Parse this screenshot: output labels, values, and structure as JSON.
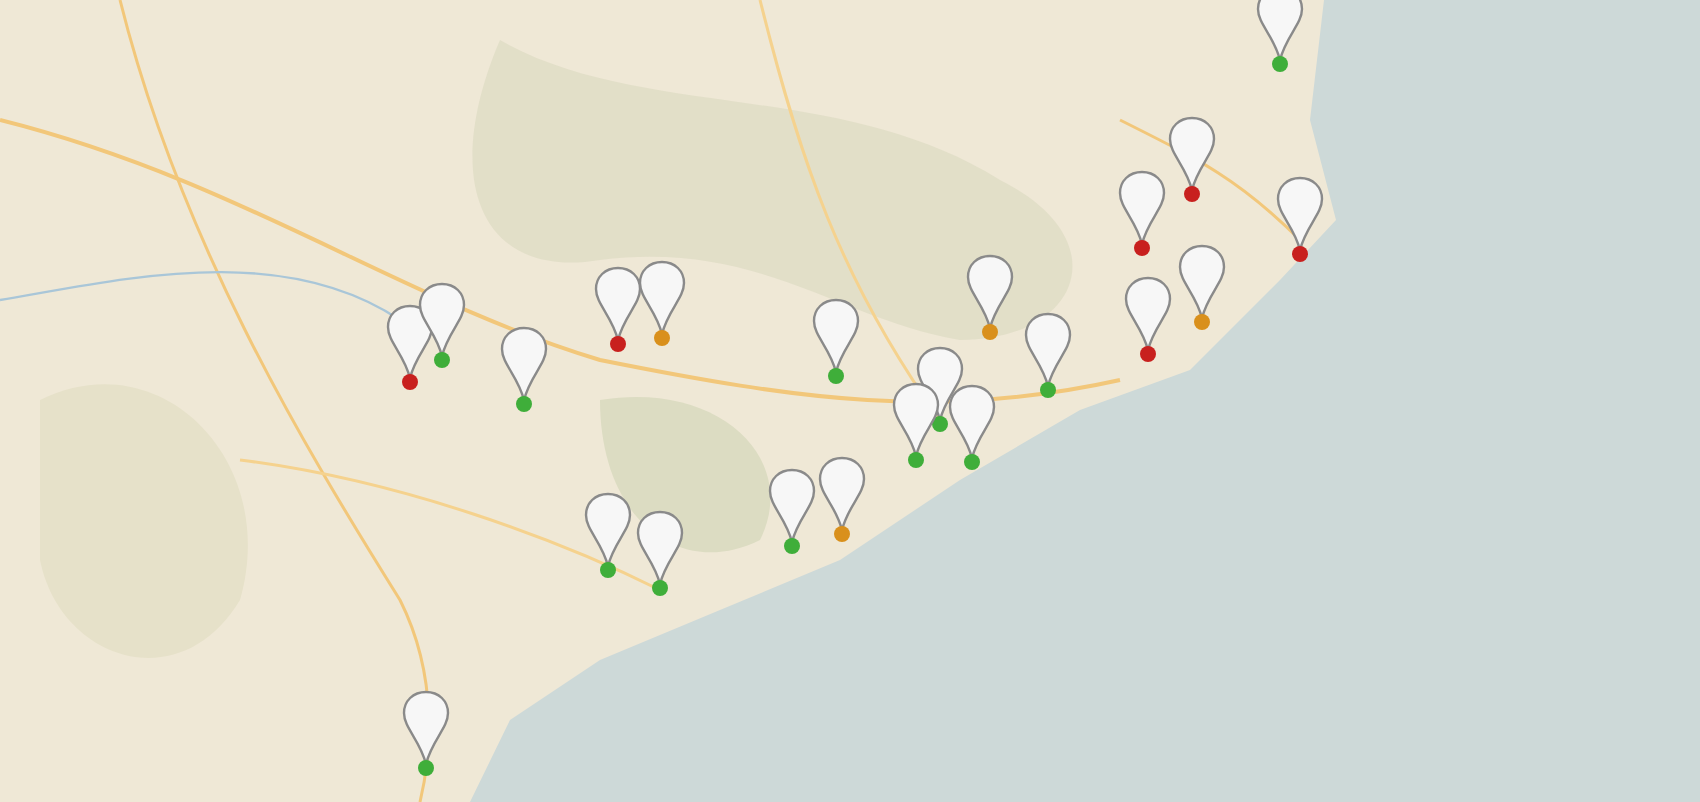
{
  "pins": [
    {
      "color": "#3fae3a"
    },
    {
      "color": "#c8201e"
    },
    {
      "color": "#c8201e"
    },
    {
      "color": "#c8201e"
    },
    {
      "color": "#d9901c"
    },
    {
      "color": "#c8201e"
    },
    {
      "color": "#d9901c"
    },
    {
      "color": "#3fae3a"
    },
    {
      "color": "#3fae3a"
    },
    {
      "color": "#c8201e"
    },
    {
      "color": "#d9901c"
    },
    {
      "color": "#c8201e"
    },
    {
      "color": "#3fae3a"
    },
    {
      "color": "#3fae3a"
    },
    {
      "color": "#3fae3a"
    },
    {
      "color": "#3fae3a"
    },
    {
      "color": "#3fae3a"
    },
    {
      "color": "#3fae3a"
    },
    {
      "color": "#d9901c"
    },
    {
      "color": "#3fae3a"
    },
    {
      "color": "#3fae3a"
    },
    {
      "color": "#3fae3a"
    }
  ]
}
